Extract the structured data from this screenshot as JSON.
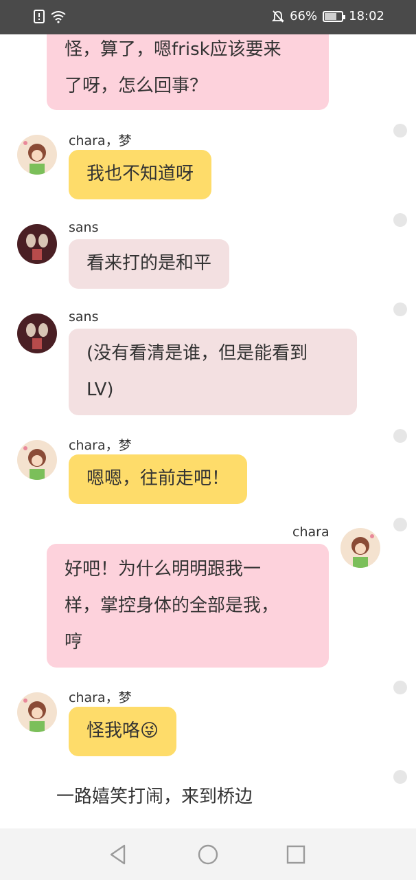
{
  "status": {
    "battery": "66%",
    "time": "18:02",
    "icons": [
      "alert-icon",
      "wifi-icon",
      "mute-icon",
      "battery-icon"
    ]
  },
  "messages": [
    {
      "side": "right",
      "lines": [
        "怪，算了，嗯frisk应该要来",
        "了呀，怎么回事？"
      ]
    },
    {
      "side": "left",
      "name": "chara，梦",
      "text": "我也不知道呀",
      "avatar": "chara-avatar"
    },
    {
      "side": "left",
      "name": "sans",
      "text": "看来打的是和平",
      "avatar": "sans-avatar"
    },
    {
      "side": "left",
      "name": "sans",
      "lines": [
        "(没有看清是谁，但是能看到",
        "LV)"
      ],
      "avatar": "sans-avatar"
    },
    {
      "side": "left",
      "name": "chara，梦",
      "text": "嗯嗯，往前走吧！",
      "avatar": "chara-avatar"
    },
    {
      "side": "right",
      "name": "chara",
      "lines": [
        "好吧！为什么明明跟我一",
        "样，掌控身体的全部是我，",
        "哼"
      ],
      "avatar": "chara-avatar"
    },
    {
      "side": "left",
      "name": "chara，梦",
      "text": "怪我咯",
      "emoji": "😜",
      "avatar": "chara-avatar"
    },
    {
      "side": "narration",
      "text": "一路嬉笑打闹，来到桥边"
    }
  ],
  "nav": [
    "back-icon",
    "home-icon",
    "recents-icon"
  ],
  "colors": {
    "pink": "#fdd2dc",
    "yellow": "#fedc6a",
    "gray": "#f3e0e1",
    "statusbar": "#4a4a4a"
  }
}
